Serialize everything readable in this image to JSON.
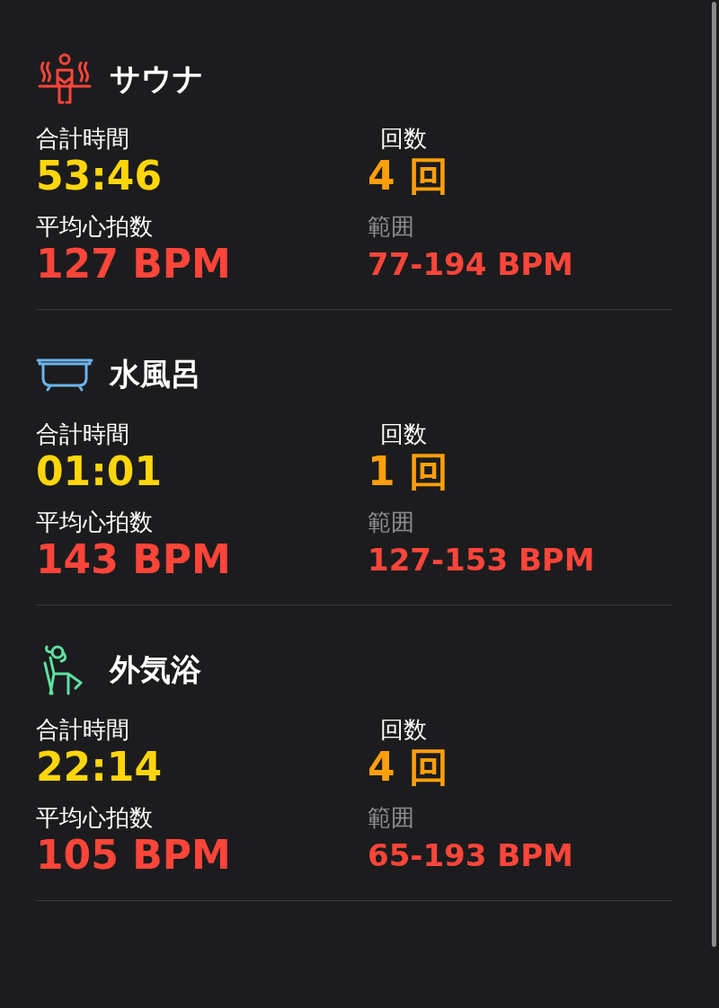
{
  "sections": [
    {
      "kind": "sauna",
      "title": "サウナ",
      "stats": [
        {
          "kind": "total",
          "label": "合計時間",
          "value": "53:46"
        },
        {
          "kind": "count",
          "label": "回数",
          "value": "4 回"
        },
        {
          "kind": "average",
          "label": "平均心拍数",
          "value": "127 BPM"
        },
        {
          "kind": "range",
          "label": "範囲",
          "value": "77-194 BPM"
        }
      ]
    },
    {
      "kind": "bath",
      "title": "水風呂",
      "stats": [
        {
          "kind": "total",
          "label": "合計時間",
          "value": "01:01"
        },
        {
          "kind": "count",
          "label": "回数",
          "value": "1 回"
        },
        {
          "kind": "average",
          "label": "平均心拍数",
          "value": "143 BPM"
        },
        {
          "kind": "range",
          "label": "範囲",
          "value": "127-153 BPM"
        }
      ]
    },
    {
      "kind": "rest",
      "title": "外気浴",
      "stats": [
        {
          "kind": "total",
          "label": "合計時間",
          "value": "22:14"
        },
        {
          "kind": "count",
          "label": "回数",
          "value": "4 回"
        },
        {
          "kind": "average",
          "label": "平均心拍数",
          "value": "105 BPM"
        },
        {
          "kind": "range",
          "label": "範囲",
          "value": "65-193 BPM"
        }
      ]
    }
  ]
}
